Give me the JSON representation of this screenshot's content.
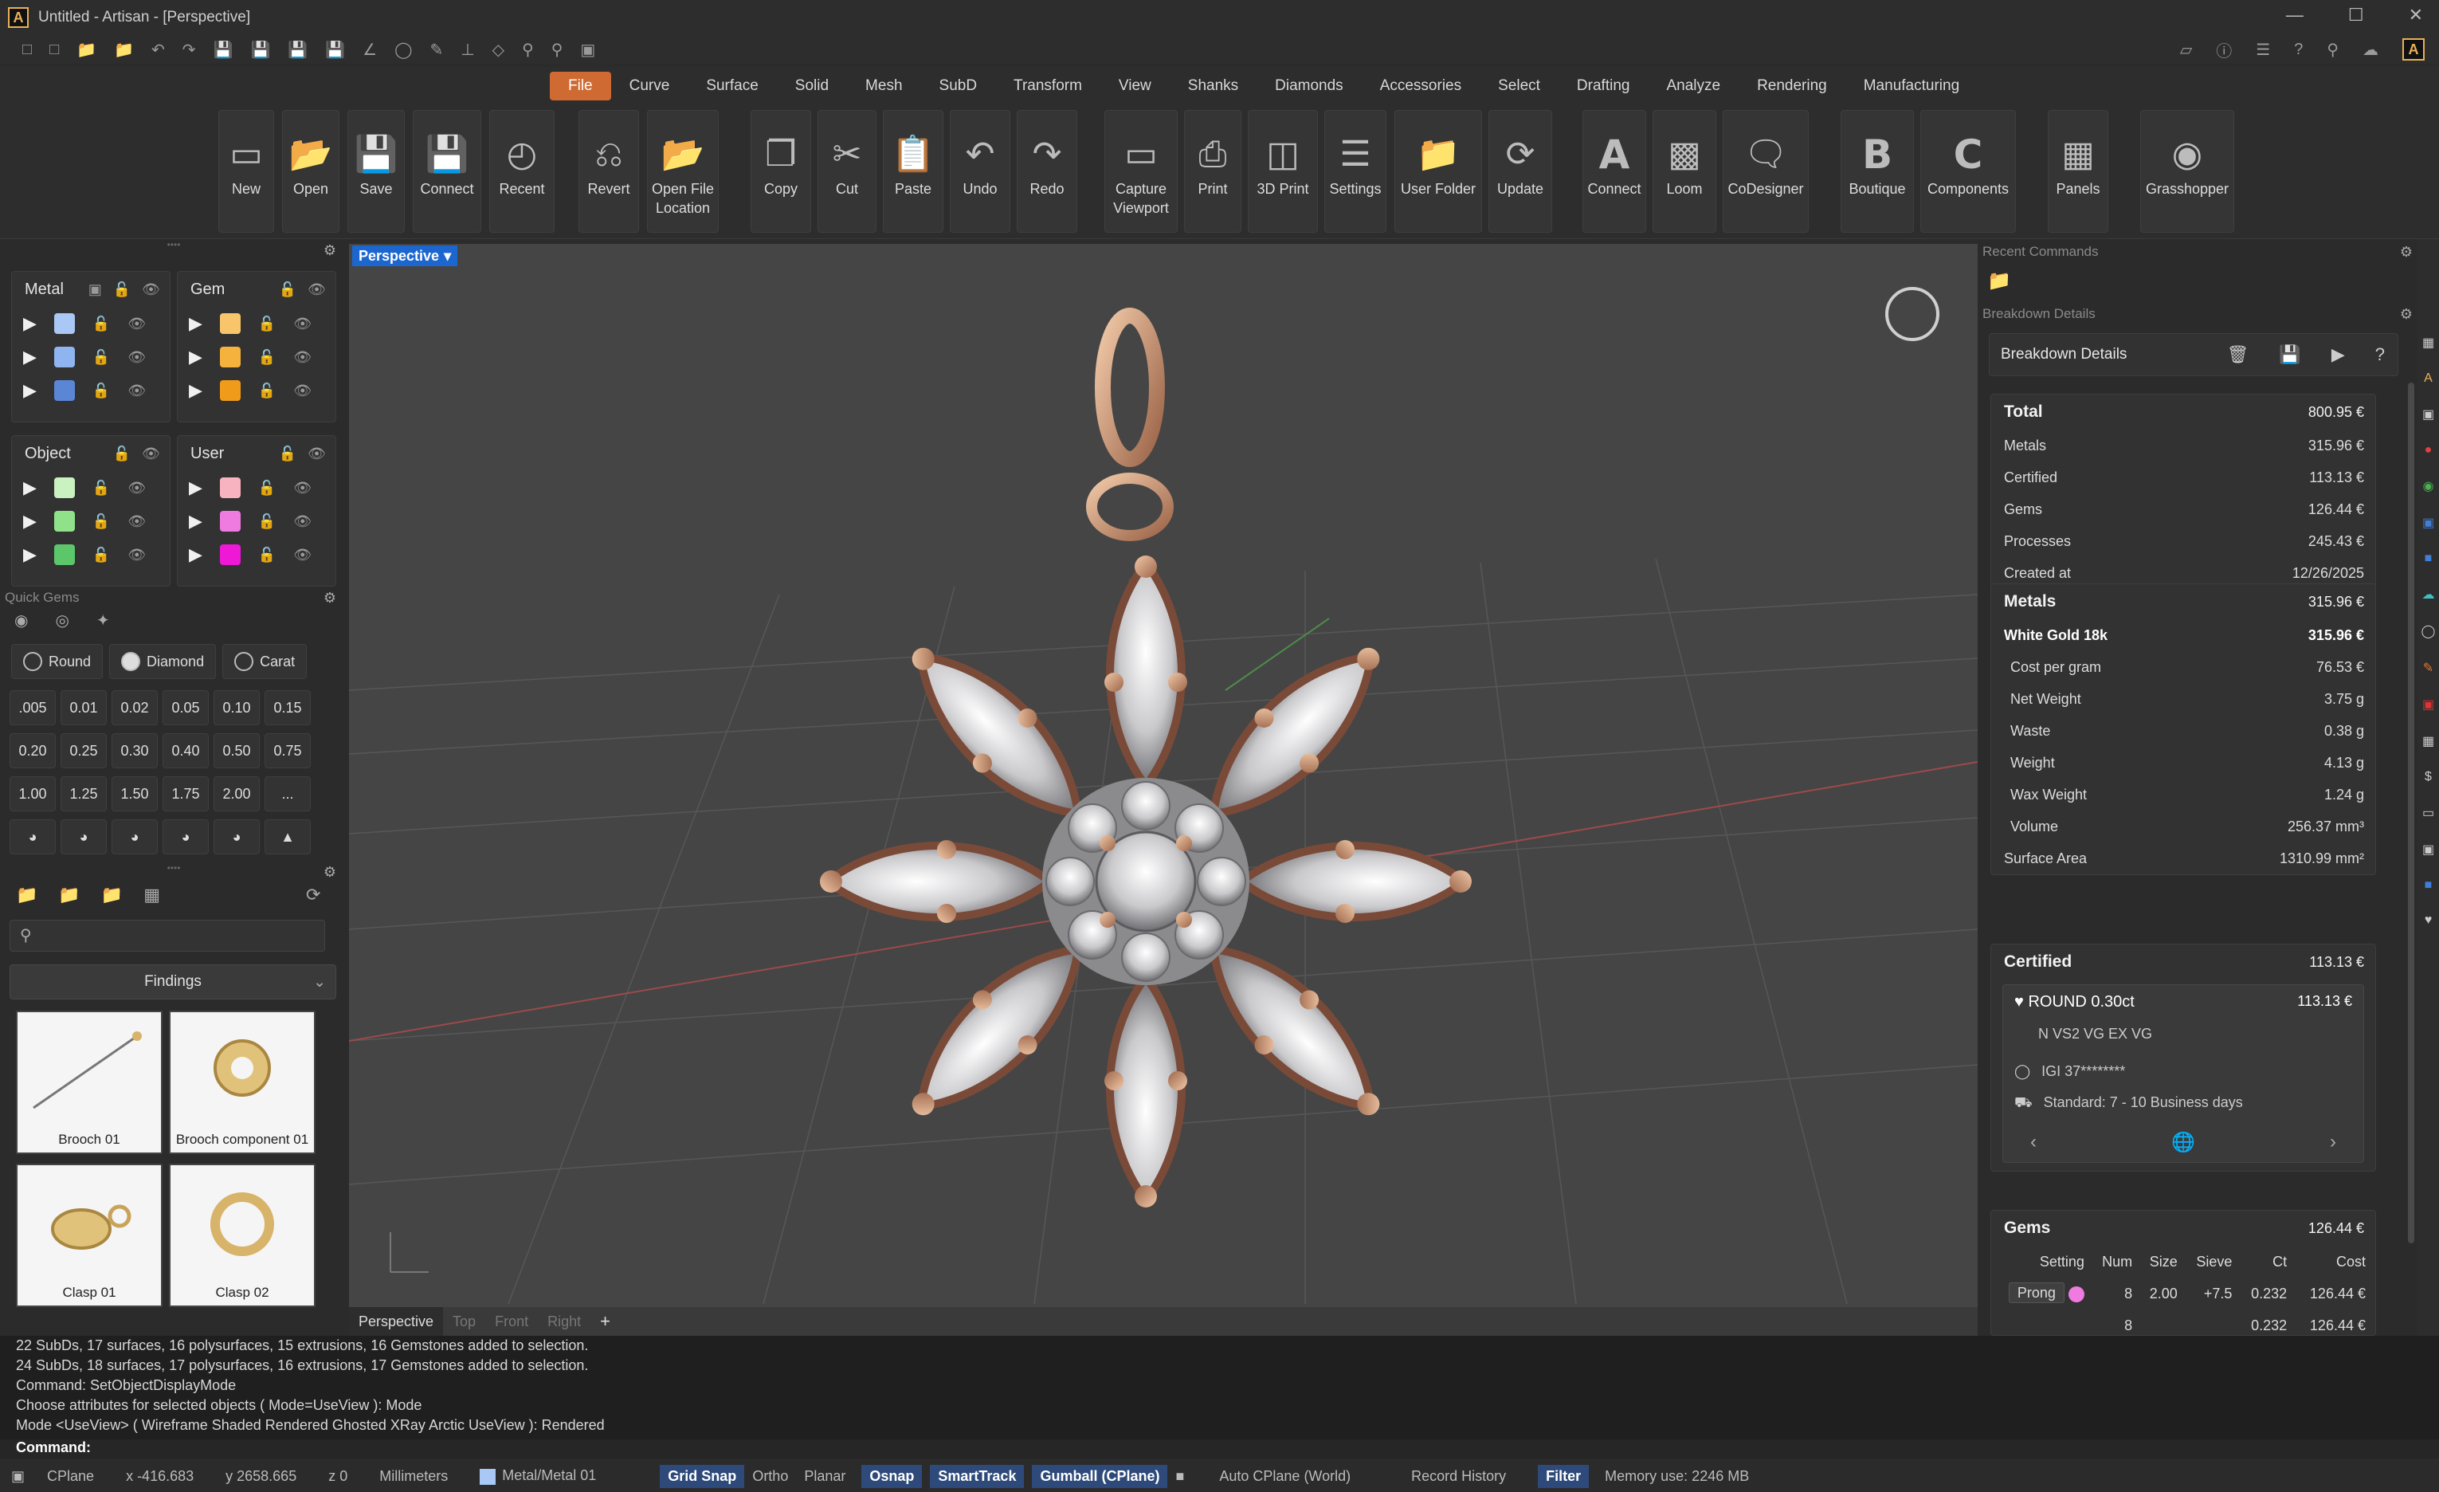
{
  "window": {
    "title": "Untitled - Artisan - [Perspective]"
  },
  "tabs": [
    "File",
    "Curve",
    "Surface",
    "Solid",
    "Mesh",
    "SubD",
    "Transform",
    "View",
    "Shanks",
    "Diamonds",
    "Accessories",
    "Select",
    "Drafting",
    "Analyze",
    "Rendering",
    "Manufacturing"
  ],
  "ribbon": {
    "new": "New",
    "open": "Open",
    "save": "Save",
    "connect": "Connect",
    "recent": "Recent",
    "revert": "Revert",
    "open_file_location": "Open File Location",
    "copy": "Copy",
    "cut": "Cut",
    "paste": "Paste",
    "undo": "Undo",
    "redo": "Redo",
    "capture_viewport": "Capture Viewport",
    "print": "Print",
    "print3d": "3D Print",
    "settings": "Settings",
    "user_folder": "User Folder",
    "update": "Update",
    "connect2": "Connect",
    "loom": "Loom",
    "codesigner": "CoDesigner",
    "boutique": "Boutique",
    "components": "Components",
    "panels": "Panels",
    "grasshopper": "Grasshopper"
  },
  "layers": {
    "metal": {
      "title": "Metal",
      "colors": [
        "#a9c8f5",
        "#8fb4ef",
        "#5b86d6"
      ]
    },
    "gem": {
      "title": "Gem",
      "colors": [
        "#f8c56a",
        "#f5b23d",
        "#f09c1a"
      ]
    },
    "object": {
      "title": "Object",
      "colors": [
        "#c9f2c0",
        "#8fe28a",
        "#5cc76a"
      ]
    },
    "user": {
      "title": "User",
      "colors": [
        "#f7b3c0",
        "#ef7be0",
        "#ee18d6"
      ]
    }
  },
  "quick_gems": {
    "label": "Quick Gems",
    "shape": "Round",
    "material": "Diamond",
    "unit": "Carat",
    "sizes": [
      ".005",
      "0.01",
      "0.02",
      "0.05",
      "0.10",
      "0.15",
      "0.20",
      "0.25",
      "0.30",
      "0.40",
      "0.50",
      "0.75",
      "1.00",
      "1.25",
      "1.50",
      "1.75",
      "2.00",
      "..."
    ]
  },
  "library": {
    "search_placeholder": "",
    "category": "Findings",
    "items": [
      {
        "name": "Brooch 01"
      },
      {
        "name": "Brooch component 01"
      },
      {
        "name": "Clasp 01"
      },
      {
        "name": "Clasp 02"
      }
    ]
  },
  "viewport": {
    "active": "Perspective",
    "tabs": [
      "Perspective",
      "Top",
      "Front",
      "Right"
    ]
  },
  "right": {
    "recent_commands": "Recent Commands",
    "breakdown_title": "Breakdown Details",
    "breakdown_header": "Breakdown Details",
    "total": {
      "label": "Total",
      "value": "800.95 €"
    },
    "summary": [
      {
        "k": "Metals",
        "v": "315.96 €"
      },
      {
        "k": "Certified",
        "v": "113.13 €"
      },
      {
        "k": "Gems",
        "v": "126.44 €"
      },
      {
        "k": "Processes",
        "v": "245.43 €"
      },
      {
        "k": "Created at",
        "v": "12/26/2025"
      }
    ],
    "metals": {
      "label": "Metals",
      "value": "315.96 €",
      "material": "White Gold 18k",
      "material_value": "315.96 €",
      "rows": [
        {
          "k": "Cost per gram",
          "v": "76.53 €"
        },
        {
          "k": "Net Weight",
          "v": "3.75 g"
        },
        {
          "k": "Waste",
          "v": "0.38 g"
        },
        {
          "k": "Weight",
          "v": "4.13 g"
        },
        {
          "k": "Wax Weight",
          "v": "1.24 g"
        },
        {
          "k": "Volume",
          "v": "256.37 mm³"
        },
        {
          "k": "Surface Area",
          "v": "1310.99 mm²"
        }
      ]
    },
    "certified": {
      "label": "Certified",
      "value": "113.13 €",
      "gem": "ROUND 0.30ct",
      "gem_value": "113.13 €",
      "grade": "N VS2 VG EX VG",
      "lab": "IGI 37********",
      "shipping": "Standard: 7 - 10 Business days"
    },
    "gems": {
      "label": "Gems",
      "value": "126.44 €",
      "columns": [
        "Setting",
        "Num",
        "Size",
        "Sieve",
        "Ct",
        "Cost"
      ],
      "rows": [
        {
          "setting": "Prong",
          "num": "8",
          "size": "2.00",
          "sieve": "+7.5",
          "ct": "0.232",
          "cost": "126.44 €"
        },
        {
          "setting": "",
          "num": "8",
          "size": "",
          "sieve": "",
          "ct": "0.232",
          "cost": "126.44 €"
        }
      ]
    }
  },
  "command_history": [
    "22 SubDs, 17 surfaces, 16 polysurfaces, 15 extrusions, 16 Gemstones added to selection.",
    "24 SubDs, 18 surfaces, 17 polysurfaces, 16 extrusions, 17 Gemstones added to selection.",
    "Command: SetObjectDisplayMode",
    "Choose attributes for selected objects ( Mode=UseView ): Mode",
    "Mode <UseView> ( Wireframe  Shaded  Rendered  Ghosted  XRay  Arctic  UseView ): Rendered"
  ],
  "command_prompt": "Command:",
  "status": {
    "cplane": "CPlane",
    "x": "x -416.683",
    "y": "y 2658.665",
    "z": "z 0",
    "units": "Millimeters",
    "layer": "Metal/Metal 01",
    "grid_snap": "Grid Snap",
    "ortho": "Ortho",
    "planar": "Planar",
    "osnap": "Osnap",
    "smarttrack": "SmartTrack",
    "gumball": "Gumball (CPlane)",
    "auto_cplane": "Auto CPlane (World)",
    "record_history": "Record History",
    "filter": "Filter",
    "memory": "Memory use: 2246 MB"
  }
}
